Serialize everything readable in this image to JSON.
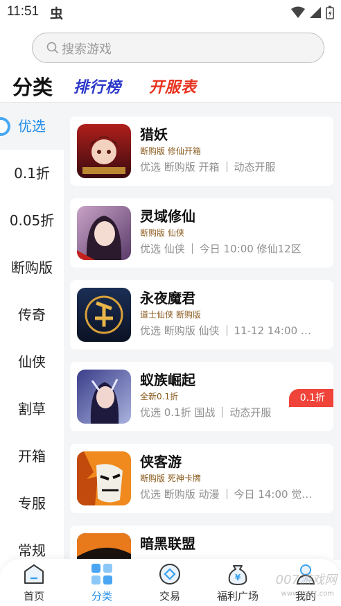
{
  "status_bar": {
    "time": "11:51",
    "bug_glyph": "虫"
  },
  "search": {
    "placeholder": "搜索游戏"
  },
  "top_tabs": {
    "category": "分类",
    "ranking": "排行榜",
    "server_list": "开服表"
  },
  "sidebar": {
    "items": [
      {
        "label": "优选",
        "active": true
      },
      {
        "label": "0.1折"
      },
      {
        "label": "0.05折"
      },
      {
        "label": "断购版"
      },
      {
        "label": "传奇"
      },
      {
        "label": "仙侠"
      },
      {
        "label": "割草"
      },
      {
        "label": "开箱"
      },
      {
        "label": "专服"
      },
      {
        "label": "常规"
      }
    ]
  },
  "games": [
    {
      "name": "猎妖",
      "sub": "断购版 修仙开箱",
      "tags": "优选  断购版  开箱",
      "server": "动态开服"
    },
    {
      "name": "灵域修仙",
      "sub": "断购版 仙侠",
      "tags": "优选  仙侠",
      "server": "今日 10:00 修仙12区"
    },
    {
      "name": "永夜魔君",
      "sub": "道士仙侠 断购版",
      "tags": "优选  断购版  仙侠",
      "server": "11-12 14:00 …"
    },
    {
      "name": "蚁族崛起",
      "sub": "全新0.1折",
      "tags": "优选  0.1折  国战",
      "server": "动态开服",
      "badge": "0.1折"
    },
    {
      "name": "侠客游",
      "sub": "断购版 死神卡牌",
      "tags": "优选  断购版  动漫",
      "server": "今日 14:00 觉…"
    },
    {
      "name": "暗黑联盟",
      "sub": "",
      "tags": "",
      "server": ""
    }
  ],
  "bottom_nav": {
    "items": [
      {
        "label": "首页"
      },
      {
        "label": "分类",
        "active": true
      },
      {
        "label": "交易"
      },
      {
        "label": "福利广场"
      },
      {
        "label": "我的"
      }
    ]
  },
  "watermark": {
    "text": "007游戏网",
    "url": "www.y007.com"
  },
  "colors": {
    "accent": "#1e8be8",
    "rank": "#2a36c9",
    "open": "#e8321e",
    "badge": "#f0433a"
  }
}
